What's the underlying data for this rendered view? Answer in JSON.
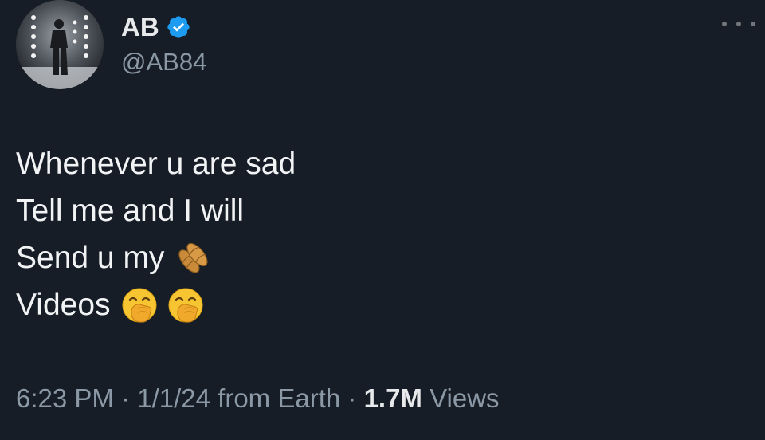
{
  "author": {
    "display_name": "AB",
    "handle": "@AB84",
    "verified": true,
    "verified_color": "#1d9bf0"
  },
  "menu": {
    "icon": "more-horizontal-icon"
  },
  "tweet": {
    "lines": [
      {
        "text": "Whenever u are sad"
      },
      {
        "text": "Tell me and I will"
      },
      {
        "text": "Send u my",
        "emojis": [
          "peanuts-emoji"
        ]
      },
      {
        "text": "Videos",
        "emojis": [
          "face-with-hand-over-mouth-emoji",
          "face-with-hand-over-mouth-emoji"
        ]
      }
    ]
  },
  "meta": {
    "time": "6:23 PM",
    "separator": "·",
    "date": "1/1/24",
    "source": "from Earth",
    "views_count": "1.7M",
    "views_label": "Views"
  },
  "colors": {
    "background": "#161d27",
    "primary_text": "#e7e9ea",
    "secondary_text": "#8b98a5"
  }
}
